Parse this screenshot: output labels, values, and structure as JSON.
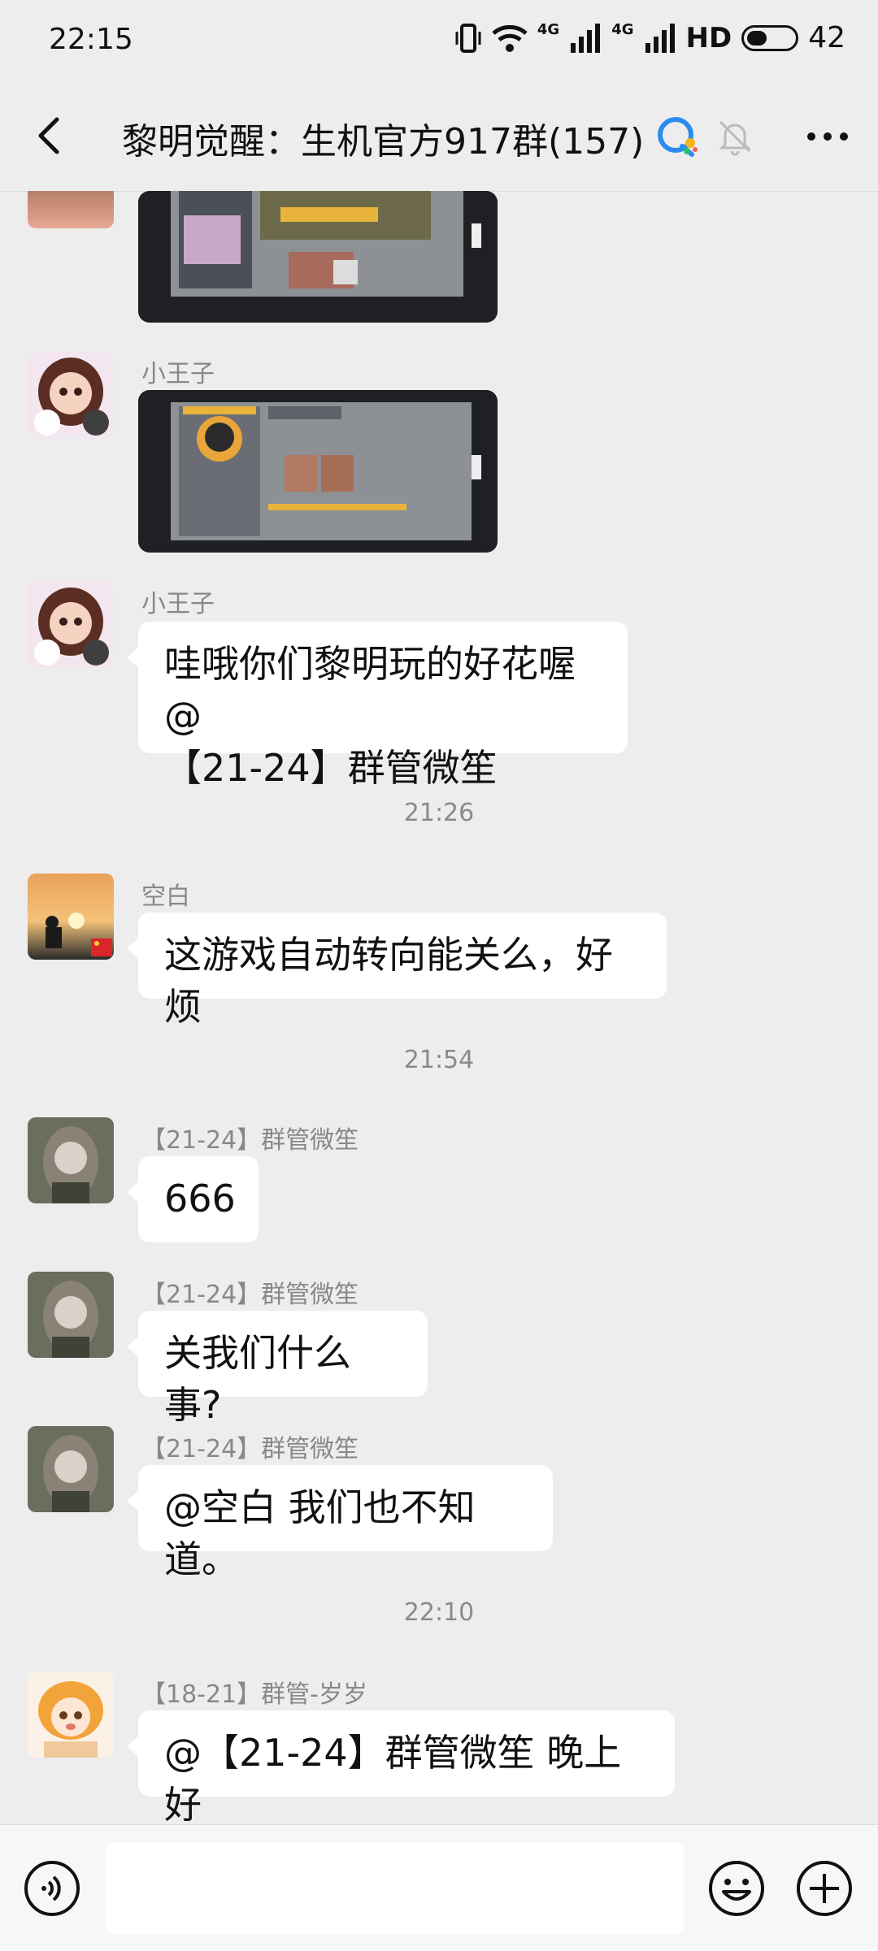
{
  "status_bar": {
    "time": "22:15",
    "network": "4G",
    "hd": "HD",
    "battery": "42",
    "battery_level": 0.42
  },
  "header": {
    "title": "黎明觉醒：生机官方917群(157)",
    "icons": [
      "back-icon",
      "qq-chat-icon",
      "mute-bell-icon",
      "more-icon"
    ]
  },
  "messages": [
    {
      "type": "image",
      "sender": "",
      "avatar": "girl-with-dogs-avatar"
    },
    {
      "type": "image",
      "sender": "小王子",
      "avatar": "girl-with-dogs-avatar"
    },
    {
      "type": "text",
      "sender": "小王子",
      "avatar": "girl-with-dogs-avatar",
      "lines": [
        "哇哦你们黎明玩的好花喔@",
        "【21-24】群管微笙"
      ]
    },
    {
      "type": "time",
      "text": "21:26"
    },
    {
      "type": "text",
      "sender": "空白",
      "avatar": "sunset-person-avatar",
      "lines": [
        "这游戏自动转向能关么，好烦"
      ]
    },
    {
      "type": "time",
      "text": "21:54"
    },
    {
      "type": "text",
      "sender": "【21-24】群管微笙",
      "avatar": "anime-girl-forest-avatar",
      "lines": [
        "666"
      ]
    },
    {
      "type": "text",
      "sender": "【21-24】群管微笙",
      "avatar": "anime-girl-forest-avatar",
      "lines": [
        "关我们什么事?"
      ]
    },
    {
      "type": "text",
      "sender": "【21-24】群管微笙",
      "avatar": "anime-girl-forest-avatar",
      "lines": [
        "@空白  我们也不知道。"
      ]
    },
    {
      "type": "time",
      "text": "22:10"
    },
    {
      "type": "text",
      "sender": "【18-21】群管-岁岁",
      "avatar": "orange-hair-anime-avatar",
      "lines": [
        "@【21-24】群管微笙  晚上好"
      ]
    }
  ],
  "input_bar": {
    "placeholder": "",
    "icons": [
      "voice-icon",
      "emoji-icon",
      "plus-icon"
    ]
  },
  "colors": {
    "background": "#ededed",
    "bubble": "#ffffff",
    "input_bar": "#f7f7f7"
  }
}
